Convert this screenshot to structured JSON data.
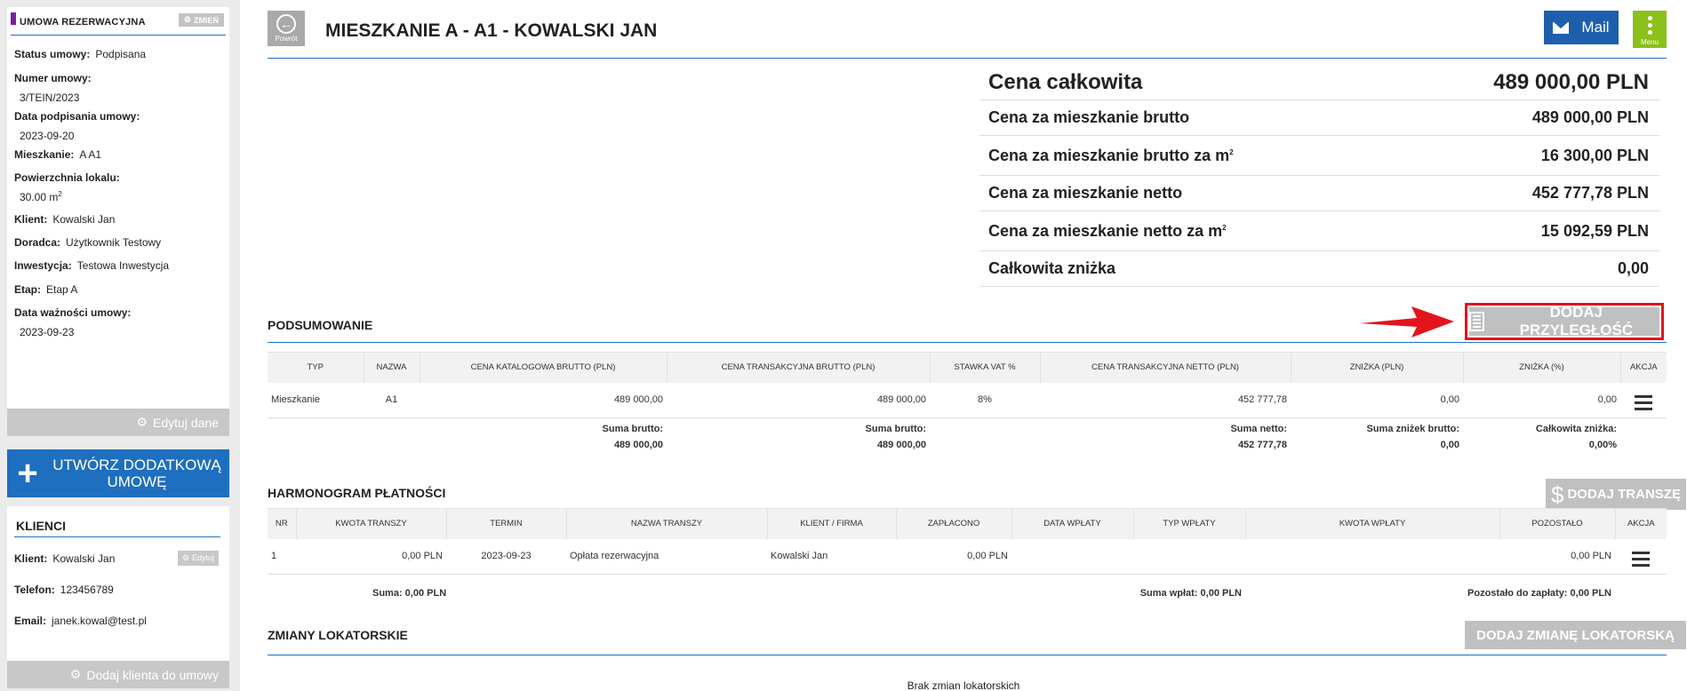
{
  "sidebar": {
    "contract_card": {
      "title": "UMOWA REZERWACYJNA",
      "change_label": "ZMIEŃ",
      "fields": {
        "status_label": "Status umowy:",
        "status_value": "Podpisana",
        "number_label": "Numer umowy:",
        "number_value": "3/TEIN/2023",
        "sign_date_label": "Data podpisania umowy:",
        "sign_date_value": "2023-09-20",
        "apartment_label": "Mieszkanie:",
        "apartment_value": "A A1",
        "area_label": "Powierzchnia lokalu:",
        "area_value": "30.00 m",
        "area_sup": "2",
        "client_label": "Klient:",
        "client_value": "Kowalski Jan",
        "advisor_label": "Doradca:",
        "advisor_value": "Użytkownik Testowy",
        "investment_label": "Inwestycja:",
        "investment_value": "Testowa Inwestycja",
        "stage_label": "Etap:",
        "stage_value": "Etap A",
        "validity_label": "Data ważności umowy:",
        "validity_value": "2023-09-23"
      },
      "edit_label": "Edytuj dane"
    },
    "create_contract_label": "UTWÓRZ DODATKOWĄ UMOWĘ",
    "clients_card": {
      "title": "KLIENCI",
      "edit_label": "Edytuj",
      "client_label": "Klient:",
      "client_value": "Kowalski Jan",
      "phone_label": "Telefon:",
      "phone_value": "123456789",
      "email_label": "Email:",
      "email_value": "janek.kowal@test.pl",
      "add_client_label": "Dodaj klienta do umowy"
    }
  },
  "header": {
    "back_label": "Powrót",
    "title": "MIESZKANIE A - A1 - KOWALSKI JAN",
    "mail_label": "Mail",
    "menu_label": "Menu"
  },
  "prices": {
    "total_label": "Cena całkowita",
    "total_value": "489 000,00 PLN",
    "gross_label": "Cena za mieszkanie brutto",
    "gross_value": "489 000,00 PLN",
    "gross_m2_label": "Cena za mieszkanie brutto za m",
    "gross_m2_value": "16 300,00 PLN",
    "net_label": "Cena za mieszkanie netto",
    "net_value": "452 777,78 PLN",
    "net_m2_label": "Cena za mieszkanie netto za m",
    "net_m2_value": "15 092,59 PLN",
    "discount_label": "Całkowita zniżka",
    "discount_value": "0,00",
    "sup": "2"
  },
  "summary": {
    "title": "PODSUMOWANIE",
    "add_adjacency_label": "DODAJ PRZYLEGŁOŚĆ",
    "headers": [
      "TYP",
      "NAZWA",
      "CENA KATALOGOWA BRUTTO (PLN)",
      "CENA TRANSAKCYJNA BRUTTO (PLN)",
      "STAWKA VAT %",
      "CENA TRANSAKCYJNA NETTO (PLN)",
      "ZNIŻKA (PLN)",
      "ZNIŻKA (%)",
      "AKCJA"
    ],
    "row": [
      "Mieszkanie",
      "A1",
      "489 000,00",
      "489 000,00",
      "8%",
      "452 777,78",
      "0,00",
      "0,00"
    ],
    "sums": {
      "gross1_label": "Suma brutto:",
      "gross1_value": "489 000,00",
      "gross2_label": "Suma brutto:",
      "gross2_value": "489 000,00",
      "net_label": "Suma netto:",
      "net_value": "452 777,78",
      "disc_label": "Suma zniżek brutto:",
      "disc_value": "0,00",
      "total_disc_label": "Całkowita zniżka:",
      "total_disc_value": "0,00%"
    }
  },
  "payments": {
    "title": "HARMONOGRAM PŁATNOŚCI",
    "add_tranche_label": "DODAJ TRANSZĘ",
    "headers": [
      "NR",
      "KWOTA TRANSZY",
      "TERMIN",
      "NAZWA TRANSZY",
      "KLIENT / FIRMA",
      "ZAPŁACONO",
      "DATA WPŁATY",
      "TYP WPŁATY",
      "KWOTA WPŁATY",
      "POZOSTAŁO",
      "AKCJA"
    ],
    "row": [
      "1",
      "0,00 PLN",
      "2023-09-23",
      "Opłata rezerwacyjna",
      "Kowalski Jan",
      "0,00 PLN",
      "",
      "",
      "",
      "0,00 PLN"
    ],
    "sum_label": "Suma: 0,00 PLN",
    "paid_sum_label": "Suma wpłat: 0,00 PLN",
    "remaining_label": "Pozostało do zapłaty: 0,00 PLN"
  },
  "tenant_changes": {
    "title": "ZMIANY LOKATORSKIE",
    "add_label": "DODAJ ZMIANĘ LOKATORSKĄ",
    "empty_label": "Brak zmian lokatorskich"
  },
  "colors": {
    "accent": "#1e73be",
    "menu_green": "#8cc01a",
    "highlight_red": "#e3141b",
    "contract_purple": "#7b1fa2"
  }
}
